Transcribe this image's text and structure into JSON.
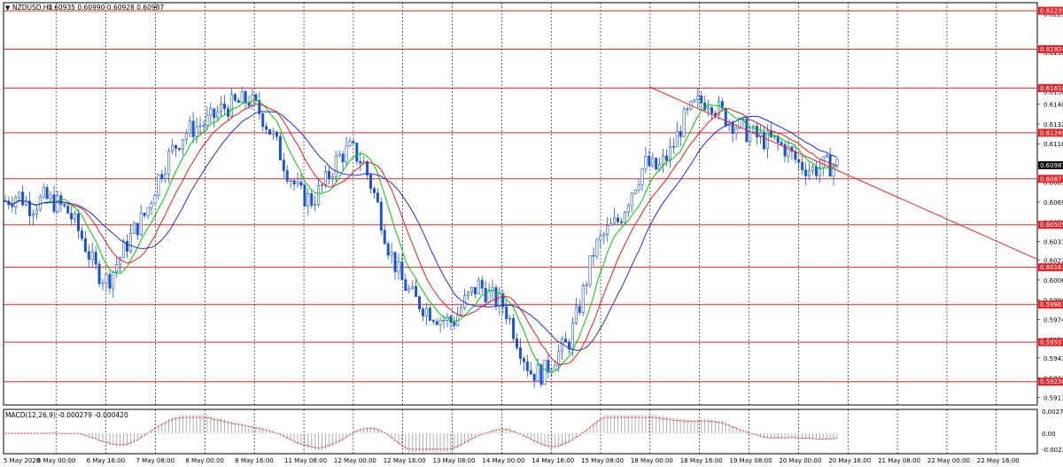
{
  "header": {
    "symbol": "NZDUSD,H1",
    "ohlc": "0.60935 0.60990 0.60928 0.60987"
  },
  "macd": {
    "label": "MACD(12,26,9) -0.000279 -0.000420",
    "ticks": [
      "0.002743",
      "0.00",
      "-0.00233"
    ]
  },
  "colors": {
    "up_candle": "#1b55c8",
    "grid": "#000000",
    "level_line": "#e3262b",
    "ma_fast": "#00cc00",
    "ma_mid": "#e02020",
    "ma_slow": "#2030d0",
    "macd_hist": "#b0b0b0",
    "macd_signal": "#e02020",
    "price_tag": "#000000"
  },
  "chart_data": {
    "type": "candlestick",
    "instrument": "NZDUSD",
    "timeframe": "H1",
    "current_price": 0.60987,
    "x_labels": [
      "5 May 2020",
      "6 May 00:00",
      "6 May 16:00",
      "7 May 08:00",
      "8 May 00:00",
      "8 May 16:00",
      "11 May 08:00",
      "12 May 00:00",
      "12 May 16:00",
      "13 May 08:00",
      "14 May 00:00",
      "14 May 16:00",
      "15 May 08:00",
      "18 May 00:00",
      "18 May 16:00",
      "19 May 08:00",
      "20 May 00:00",
      "20 May 16:00",
      "21 May 08:00",
      "22 May 00:00",
      "22 May 16:00"
    ],
    "y_ticks": [
      0.6221,
      0.619,
      0.6158,
      0.6148,
      0.6132,
      0.6116,
      0.6085,
      0.6069,
      0.6053,
      0.6037,
      0.6022,
      0.6006,
      0.599,
      0.5974,
      0.5958,
      0.5943,
      0.5927,
      0.5911
    ],
    "horizontal_levels": [
      "0.62235",
      "0.61924",
      "0.61610",
      "0.61249",
      "0.60877",
      "0.60505",
      "0.60162",
      "0.59861",
      "0.59557",
      "0.59238"
    ],
    "price_series": [
      0.607,
      0.6075,
      0.6065,
      0.6072,
      0.6068,
      0.606,
      0.604,
      0.6015,
      0.6005,
      0.6025,
      0.6045,
      0.606,
      0.609,
      0.611,
      0.6125,
      0.613,
      0.6135,
      0.6145,
      0.6148,
      0.6152,
      0.614,
      0.612,
      0.6095,
      0.6075,
      0.607,
      0.6085,
      0.6105,
      0.6112,
      0.61,
      0.607,
      0.603,
      0.6005,
      0.599,
      0.5982,
      0.5975,
      0.5972,
      0.599,
      0.6002,
      0.5992,
      0.5985,
      0.5958,
      0.5932,
      0.593,
      0.5945,
      0.5955,
      0.599,
      0.603,
      0.6045,
      0.6055,
      0.608,
      0.61,
      0.6095,
      0.611,
      0.6135,
      0.6148,
      0.6152,
      0.614,
      0.6132,
      0.6125,
      0.612,
      0.6118,
      0.6112,
      0.61,
      0.6095,
      0.6098,
      0.6099
    ],
    "trendline": {
      "from": 0.6162,
      "to": 0.6023
    }
  }
}
